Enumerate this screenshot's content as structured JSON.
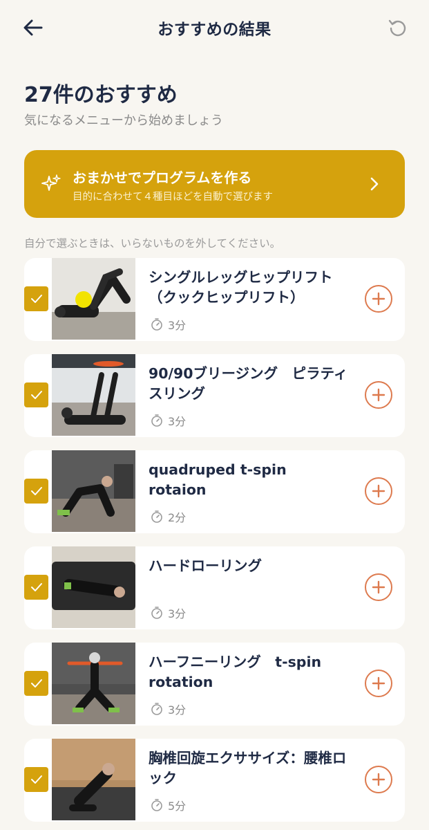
{
  "header": {
    "title": "おすすめの結果"
  },
  "summary": {
    "title": "27件のおすすめ",
    "subtitle": "気になるメニューから始めましょう"
  },
  "auto_program": {
    "label": "おまかせでプログラムを作る",
    "sublabel": "目的に合わせて４種目ほどを自動で選びます"
  },
  "hint": "自分で選ぶときは、いらないものを外してください。",
  "exercises": [
    {
      "name": "シングルレッグヒップリフト（クックヒップリフト）",
      "duration": "3分",
      "checked": true
    },
    {
      "name": "90/90ブリージング　ピラティスリング",
      "duration": "3分",
      "checked": true
    },
    {
      "name": "quadruped t-spin rotaion",
      "duration": "2分",
      "checked": true
    },
    {
      "name": "ハードローリング",
      "duration": "3分",
      "checked": true
    },
    {
      "name": "ハーフニーリング　t-spin rotation",
      "duration": "3分",
      "checked": true
    },
    {
      "name": "胸椎回旋エクササイズ：腰椎ロック",
      "duration": "5分",
      "checked": true
    }
  ],
  "colors": {
    "accent": "#d5a20d",
    "add": "#dd7a4e",
    "text": "#1f2a44",
    "background": "#f8f6f1"
  },
  "icons": {
    "back": "arrow-left-icon",
    "reset": "reset-icon",
    "sparkle": "sparkle-icon",
    "chevron": "chevron-right-icon",
    "check": "check-icon",
    "timer": "stopwatch-icon",
    "add": "plus-circle-icon"
  }
}
